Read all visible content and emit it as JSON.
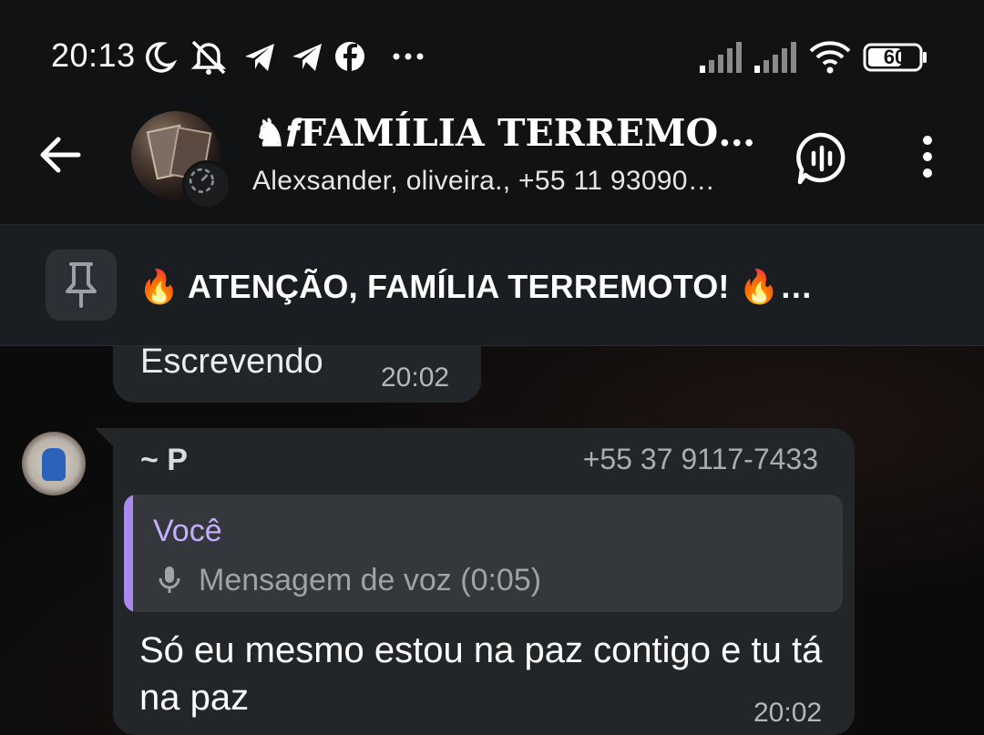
{
  "status_bar": {
    "time": "20:13",
    "battery": "60",
    "icons": [
      "moon-icon",
      "muted-alarm-icon",
      "telegram-icon",
      "telegram-icon",
      "facebook-icon",
      "more-dots-icon",
      "signal-icon",
      "signal-icon",
      "wifi-icon",
      "battery-icon"
    ]
  },
  "header": {
    "title": "♞𝒇FAMÍLIA TERREMO…",
    "subtitle": "Alexsander, oliveira., +55 11 93090…",
    "back_icon": "arrow-left-icon",
    "voice_chat_icon": "voice-chat-icon",
    "menu_icon": "kebab-menu-icon"
  },
  "pinned": {
    "text": "🔥 ATENÇÃO, FAMÍLIA TERREMOTO! 🔥…",
    "icon": "pin-icon"
  },
  "messages": [
    {
      "text": "Escrevendo",
      "time": "20:02"
    },
    {
      "sender": "~ P",
      "phone": "+55 37 9117-7433",
      "reply": {
        "author": "Você",
        "text": "Mensagem de voz (0:05)",
        "icon": "microphone-icon"
      },
      "text": "Só eu mesmo estou na paz contigo e tu tá na paz",
      "time": "20:02"
    }
  ],
  "colors": {
    "background": "#0b0b0c",
    "header": "#111213",
    "bubble": "#232629",
    "reply_accent": "#a98bf0"
  }
}
